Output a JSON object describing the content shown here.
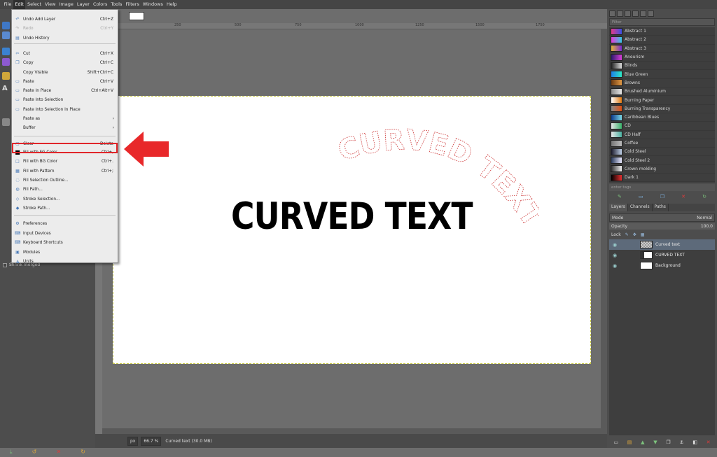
{
  "menubar": {
    "items": [
      "File",
      "Edit",
      "Select",
      "View",
      "Image",
      "Layer",
      "Colors",
      "Tools",
      "Filters",
      "Windows",
      "Help"
    ],
    "active": "Edit"
  },
  "edit_menu": {
    "items": [
      {
        "label": "Undo Add Layer",
        "shortcut": "Ctrl+Z",
        "icon": "undo-icon",
        "enabled": true
      },
      {
        "label": "Redo",
        "shortcut": "Ctrl+Y",
        "icon": "redo-icon",
        "enabled": false
      },
      {
        "label": "Undo History",
        "shortcut": "",
        "icon": "history-icon",
        "enabled": true
      },
      {
        "label": "Cut",
        "shortcut": "Ctrl+X",
        "icon": "cut-icon",
        "enabled": true
      },
      {
        "label": "Copy",
        "shortcut": "Ctrl+C",
        "icon": "copy-icon",
        "enabled": true
      },
      {
        "label": "Copy Visible",
        "shortcut": "Shift+Ctrl+C",
        "icon": "",
        "enabled": true
      },
      {
        "label": "Paste",
        "shortcut": "Ctrl+V",
        "icon": "paste-icon",
        "enabled": true
      },
      {
        "label": "Paste In Place",
        "shortcut": "Ctrl+Alt+V",
        "icon": "paste-icon",
        "enabled": true
      },
      {
        "label": "Paste Into Selection",
        "shortcut": "",
        "icon": "paste-icon",
        "enabled": true
      },
      {
        "label": "Paste Into Selection In Place",
        "shortcut": "",
        "icon": "paste-icon",
        "enabled": true
      },
      {
        "label": "Paste as",
        "shortcut": "",
        "icon": "",
        "enabled": true,
        "submenu": true
      },
      {
        "label": "Buffer",
        "shortcut": "",
        "icon": "",
        "enabled": true,
        "submenu": true
      },
      {
        "label": "Clear",
        "shortcut": "Delete",
        "icon": "clear-icon",
        "enabled": true
      },
      {
        "label": "Fill with FG Color",
        "shortcut": "Ctrl+,",
        "icon": "fg-color-icon",
        "enabled": true,
        "highlighted": true
      },
      {
        "label": "Fill with BG Color",
        "shortcut": "Ctrl+.",
        "icon": "bg-color-icon",
        "enabled": true
      },
      {
        "label": "Fill with Pattern",
        "shortcut": "Ctrl+;",
        "icon": "pattern-icon",
        "enabled": true
      },
      {
        "label": "Fill Selection Outline...",
        "shortcut": "",
        "icon": "fill-outline-icon",
        "enabled": true
      },
      {
        "label": "Fill Path...",
        "shortcut": "",
        "icon": "fill-path-icon",
        "enabled": true
      },
      {
        "label": "Stroke Selection...",
        "shortcut": "",
        "icon": "stroke-selection-icon",
        "enabled": true
      },
      {
        "label": "Stroke Path...",
        "shortcut": "",
        "icon": "stroke-path-icon",
        "enabled": true
      },
      {
        "label": "Preferences",
        "shortcut": "",
        "icon": "preferences-icon",
        "enabled": true
      },
      {
        "label": "Input Devices",
        "shortcut": "",
        "icon": "input-devices-icon",
        "enabled": true
      },
      {
        "label": "Keyboard Shortcuts",
        "shortcut": "",
        "icon": "keyboard-icon",
        "enabled": true
      },
      {
        "label": "Modules",
        "shortcut": "",
        "icon": "modules-icon",
        "enabled": true
      },
      {
        "label": "Units",
        "shortcut": "",
        "icon": "units-icon",
        "enabled": true
      }
    ]
  },
  "toolbox": {
    "option_label": "Shrink merged"
  },
  "ruler": {
    "ticks": [
      "250",
      "500",
      "750",
      "1000",
      "1250",
      "1500",
      "1750"
    ]
  },
  "canvas": {
    "main_text": "CURVED TEXT",
    "curved_text": "CURVED TEXT"
  },
  "status": {
    "unit": "px",
    "zoom": "66.7 %",
    "text": "Curved text (30.0 MB)"
  },
  "gradients": {
    "filter_placeholder": "Filter",
    "tag_placeholder": "enter tags",
    "items": [
      {
        "name": "Abstract 1",
        "c1": "#e23b8b",
        "c2": "#3b4fe2"
      },
      {
        "name": "Abstract 2",
        "c1": "#e33ad9",
        "c2": "#35c9e4"
      },
      {
        "name": "Abstract 3",
        "c1": "#e3b43a",
        "c2": "#7a2bd0"
      },
      {
        "name": "Aneurism",
        "c1": "#2b1a6b",
        "c2": "#d83fd8"
      },
      {
        "name": "Blinds",
        "c1": "#222222",
        "c2": "#dddddd"
      },
      {
        "name": "Blue Green",
        "c1": "#1d7fe8",
        "c2": "#2ee8c4"
      },
      {
        "name": "Browns",
        "c1": "#6b3a12",
        "c2": "#e39a45"
      },
      {
        "name": "Brushed Aluminium",
        "c1": "#8a8a8a",
        "c2": "#e8e8e8"
      },
      {
        "name": "Burning Paper",
        "c1": "#ffffff",
        "c2": "#e07a12"
      },
      {
        "name": "Burning Transparency",
        "c1": "#888888",
        "c2": "#e05012"
      },
      {
        "name": "Caribbean Blues",
        "c1": "#0d3a8a",
        "c2": "#7ad8e8"
      },
      {
        "name": "CD",
        "c1": "#e8e8e8",
        "c2": "#39b06a"
      },
      {
        "name": "CD Half",
        "c1": "#e8e8e8",
        "c2": "#4ab0a0"
      },
      {
        "name": "Coffee",
        "c1": "#777777",
        "c2": "#bbbbbb"
      },
      {
        "name": "Cold Steel",
        "c1": "#1a1a2a",
        "c2": "#c0d0e8"
      },
      {
        "name": "Cold Steel 2",
        "c1": "#2a3a5a",
        "c2": "#e8e8ff"
      },
      {
        "name": "Crown molding",
        "c1": "#333333",
        "c2": "#f0f0f0"
      },
      {
        "name": "Dark 1",
        "c1": "#000000",
        "c2": "#e63030"
      }
    ]
  },
  "layers": {
    "tabs": [
      "Layers",
      "Channels",
      "Paths"
    ],
    "mode_label": "Mode",
    "mode_value": "Normal",
    "opacity_label": "Opacity",
    "opacity_value": "100.0",
    "lock_label": "Lock",
    "items": [
      {
        "name": "Curved text",
        "selected": true,
        "thumb": "checker"
      },
      {
        "name": "CURVED TEXT",
        "selected": false,
        "thumb": "text"
      },
      {
        "name": "Background",
        "selected": false,
        "thumb": "white"
      }
    ]
  },
  "colors": {
    "highlight": "#e0262a",
    "arrow": "#e8282a",
    "menu_bg": "#ececec",
    "selected_row": "#5d6a7a"
  }
}
